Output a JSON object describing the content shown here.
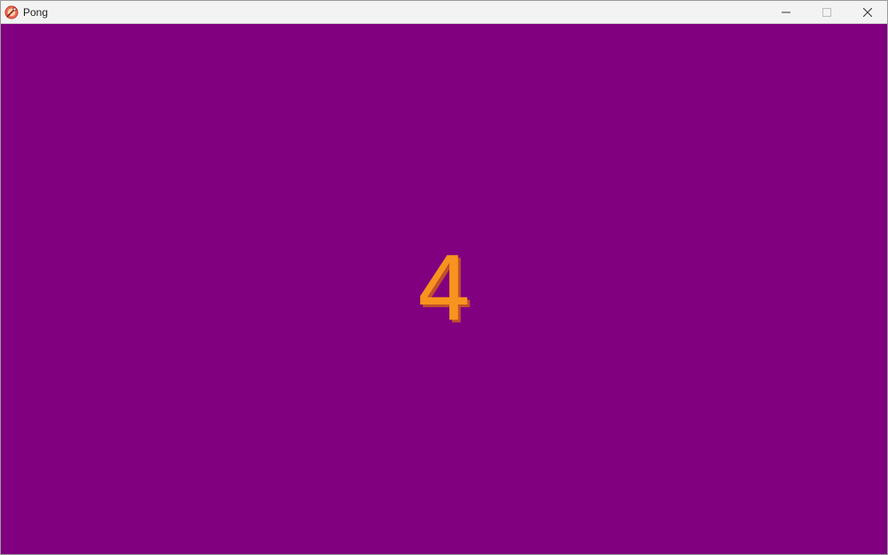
{
  "window": {
    "title": "Pong",
    "icon": "pong-app-icon",
    "controls": {
      "minimize_icon": "minimize-icon",
      "maximize_icon": "maximize-icon",
      "close_icon": "close-icon"
    }
  },
  "game": {
    "countdown": "4",
    "background_color": "#800080",
    "countdown_color": "#f7931e",
    "countdown_shadow_color": "#c0502a"
  }
}
